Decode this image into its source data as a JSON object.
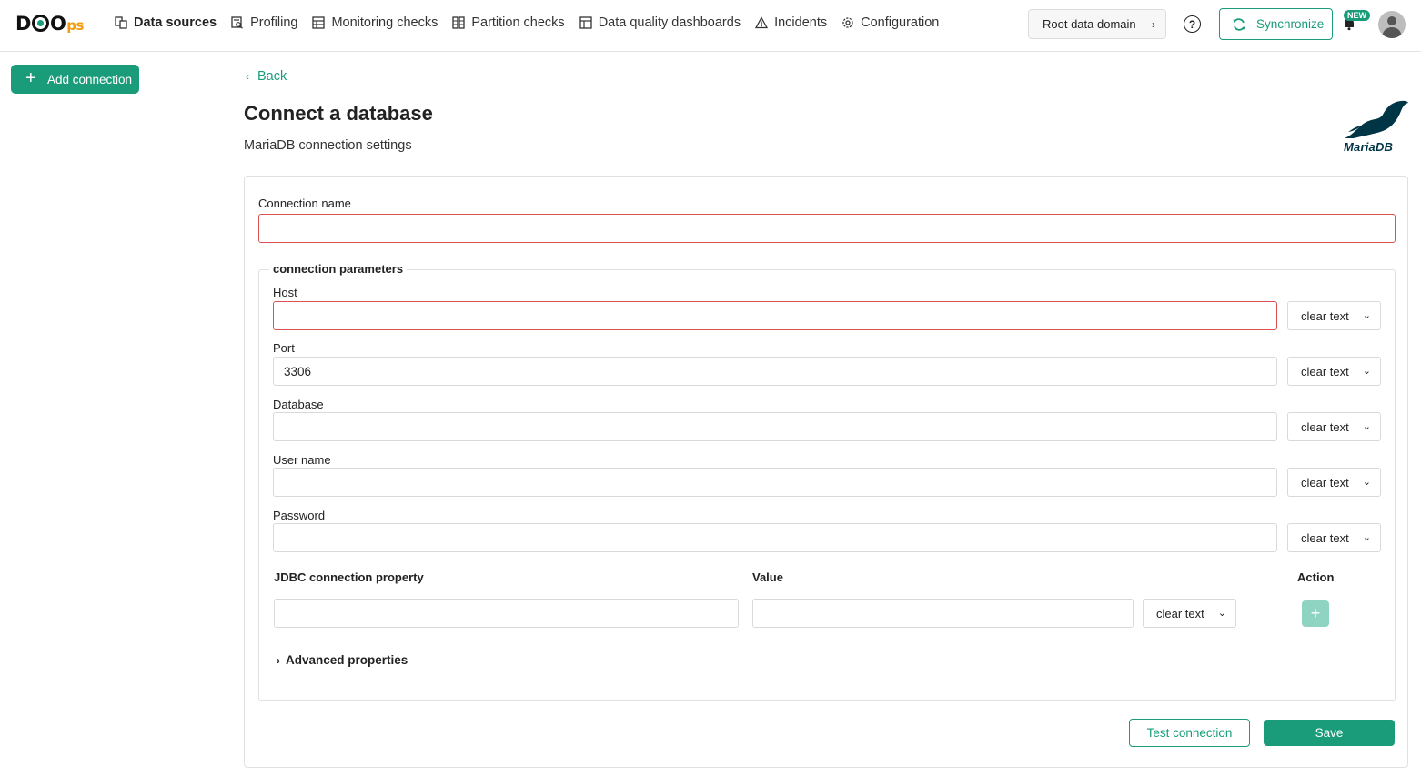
{
  "header": {
    "logo_main": "DQ",
    "logo_suffix": "ps",
    "nav": [
      {
        "label": "Data sources",
        "icon": "data-sources-icon",
        "active": true
      },
      {
        "label": "Profiling",
        "icon": "profiling-icon",
        "active": false
      },
      {
        "label": "Monitoring checks",
        "icon": "monitoring-icon",
        "active": false
      },
      {
        "label": "Partition checks",
        "icon": "partition-icon",
        "active": false
      },
      {
        "label": "Data quality dashboards",
        "icon": "dashboard-icon",
        "active": false
      },
      {
        "label": "Incidents",
        "icon": "warning-icon",
        "active": false
      },
      {
        "label": "Configuration",
        "icon": "gear-icon",
        "active": false
      }
    ],
    "domain_button": "Root data domain",
    "help_glyph": "?",
    "sync_label": "Synchronize",
    "new_badge": "NEW"
  },
  "sidebar": {
    "add_connection": "Add connection"
  },
  "main": {
    "back_label": "Back",
    "title": "Connect a database",
    "subtitle": "MariaDB connection settings",
    "logo_wordmark": "MariaDB",
    "connection_name_label": "Connection name",
    "connection_name_value": "",
    "params_legend": "connection parameters",
    "fields": [
      {
        "label": "Host",
        "value": "",
        "mode": "clear text",
        "error": true
      },
      {
        "label": "Port",
        "value": "3306",
        "mode": "clear text",
        "error": false
      },
      {
        "label": "Database",
        "value": "",
        "mode": "clear text",
        "error": false
      },
      {
        "label": "User name",
        "value": "",
        "mode": "clear text",
        "error": false
      },
      {
        "label": "Password",
        "value": "",
        "mode": "clear text",
        "error": false
      }
    ],
    "jdbc": {
      "col_property": "JDBC connection property",
      "col_value": "Value",
      "col_action": "Action",
      "property_value": "",
      "value_value": "",
      "mode": "clear text"
    },
    "advanced_label": "Advanced properties",
    "test_button": "Test connection",
    "save_button": "Save"
  },
  "colors": {
    "accent": "#1a9c7a",
    "error": "#e05252",
    "logo_orange": "#f39c12"
  }
}
